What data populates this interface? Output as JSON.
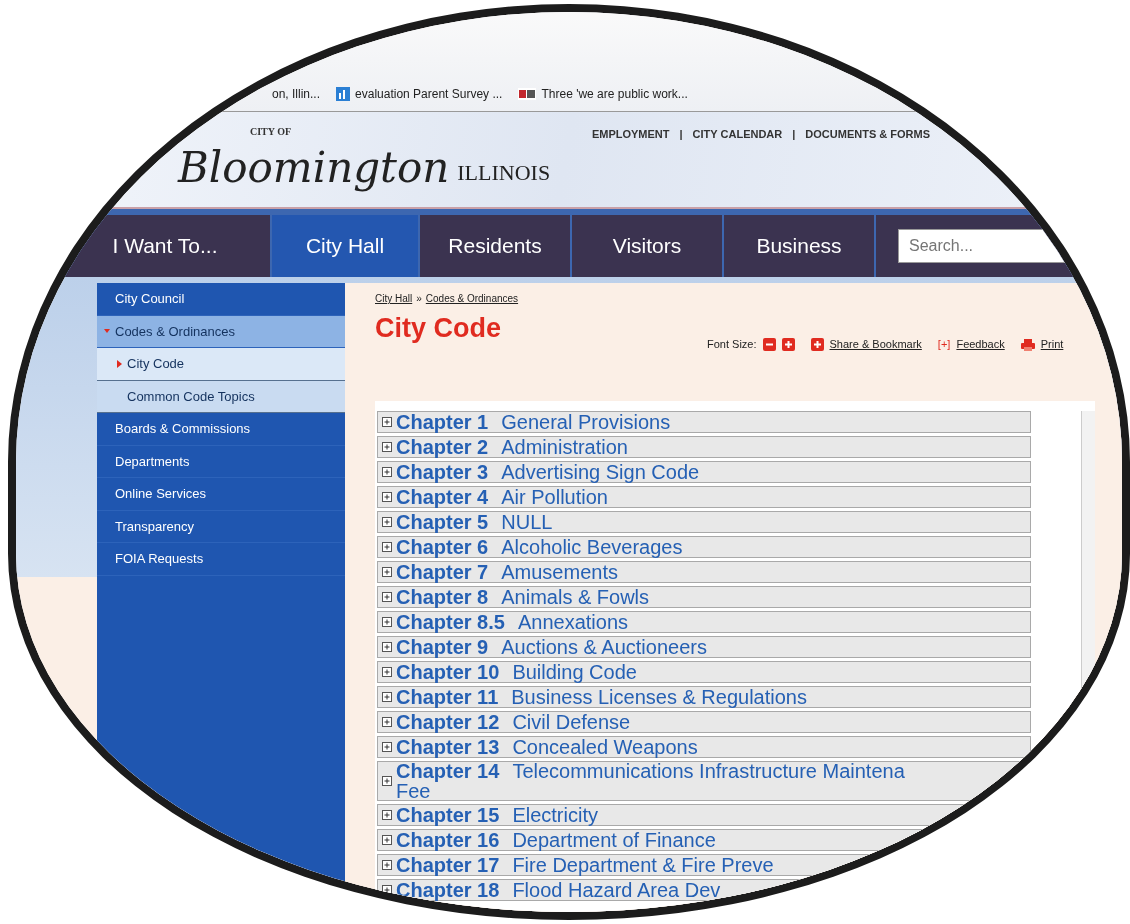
{
  "bookmarks": [
    {
      "label": "on, Illin..."
    },
    {
      "label": "evaluation Parent Survey ..."
    },
    {
      "label": "Three 'we are public work..."
    }
  ],
  "header": {
    "city_of": "CITY OF",
    "logo": "Bloomington",
    "state": "ILLINOIS",
    "links": [
      "EMPLOYMENT",
      "|",
      "CITY CALENDAR",
      "|",
      "DOCUMENTS & FORMS"
    ]
  },
  "nav": {
    "tabs": [
      {
        "label": "I Want To...",
        "selected": false
      },
      {
        "label": "City Hall",
        "selected": true
      },
      {
        "label": "Residents",
        "selected": false
      },
      {
        "label": "Visitors",
        "selected": false
      },
      {
        "label": "Business",
        "selected": false
      }
    ],
    "search": {
      "placeholder": "Search..."
    }
  },
  "sidebar": {
    "items": [
      {
        "label": "City Council",
        "expanded": false
      },
      {
        "label": "Codes & Ordinances",
        "expanded": true,
        "children": [
          {
            "label": "City Code",
            "selected": true
          },
          {
            "label": "Common Code Topics",
            "selected": false
          }
        ]
      },
      {
        "label": "Boards & Commissions",
        "expanded": false
      },
      {
        "label": "Departments",
        "expanded": false
      },
      {
        "label": "Online Services",
        "expanded": false
      },
      {
        "label": "Transparency",
        "expanded": false
      },
      {
        "label": "FOIA Requests",
        "expanded": false
      }
    ]
  },
  "breadcrumb": [
    "City Hall",
    "»",
    "Codes & Ordinances"
  ],
  "page_title": "City Code",
  "tools": {
    "font_size_label": "Font Size:",
    "share": "Share & Bookmark",
    "feedback_mark": "[+]",
    "feedback": "Feedback",
    "print": "Print"
  },
  "chapters": [
    {
      "number": "Chapter 1",
      "title": "General Provisions"
    },
    {
      "number": "Chapter 2",
      "title": "Administration"
    },
    {
      "number": "Chapter 3",
      "title": "Advertising Sign Code"
    },
    {
      "number": "Chapter 4",
      "title": "Air Pollution"
    },
    {
      "number": "Chapter 5",
      "title": "NULL"
    },
    {
      "number": "Chapter 6",
      "title": "Alcoholic Beverages"
    },
    {
      "number": "Chapter 7",
      "title": "Amusements"
    },
    {
      "number": "Chapter 8",
      "title": "Animals & Fowls"
    },
    {
      "number": "Chapter 8.5",
      "title": "Annexations"
    },
    {
      "number": "Chapter 9",
      "title": "Auctions & Auctioneers"
    },
    {
      "number": "Chapter 10",
      "title": "Building Code"
    },
    {
      "number": "Chapter 11",
      "title": "Business Licenses & Regulations"
    },
    {
      "number": "Chapter 12",
      "title": "Civil Defense"
    },
    {
      "number": "Chapter 13",
      "title": "Concealed Weapons"
    },
    {
      "number": "Chapter 14",
      "title": "Telecommunications Infrastructure Maintena",
      "title_continued": "Fee"
    },
    {
      "number": "Chapter 15",
      "title": "Electricity"
    },
    {
      "number": "Chapter 16",
      "title": "Department of Finance"
    },
    {
      "number": "Chapter 17",
      "title": "Fire Department & Fire Preve"
    },
    {
      "number": "Chapter 18",
      "title": "Flood Hazard Area Dev"
    }
  ]
}
